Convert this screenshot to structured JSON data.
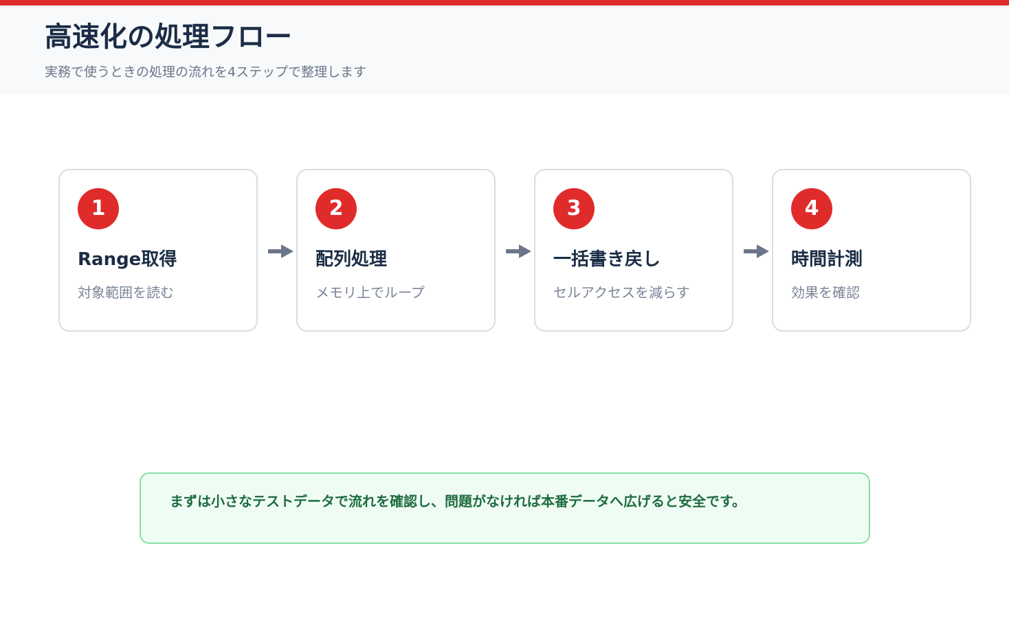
{
  "header": {
    "title": "高速化の処理フロー",
    "subtitle": "実務で使うときの処理の流れを4ステップで整理します"
  },
  "steps": [
    {
      "number": "1",
      "title": "Range取得",
      "description": "対象範囲を読む"
    },
    {
      "number": "2",
      "title": "配列処理",
      "description": "メモリ上でループ"
    },
    {
      "number": "3",
      "title": "一括書き戻し",
      "description": "セルアクセスを減らす"
    },
    {
      "number": "4",
      "title": "時間計測",
      "description": "効果を確認"
    }
  ],
  "arrows": [
    {
      "from": "1",
      "to": "2",
      "icon": "arrow-right-icon"
    },
    {
      "from": "2",
      "to": "3",
      "icon": "arrow-right-icon"
    },
    {
      "from": "3",
      "to": "4",
      "icon": "arrow-right-icon"
    }
  ],
  "note": {
    "text": "まずは小さなテストデータで流れを確認し、問題がなければ本番データへ広げると安全です。"
  },
  "colors": {
    "accent": "#e02b2b",
    "arrow": "#6b7689",
    "title": "#1b2d45",
    "note_border": "#86e0a4",
    "note_background": "#effcf3",
    "note_text": "#1d6b40"
  }
}
